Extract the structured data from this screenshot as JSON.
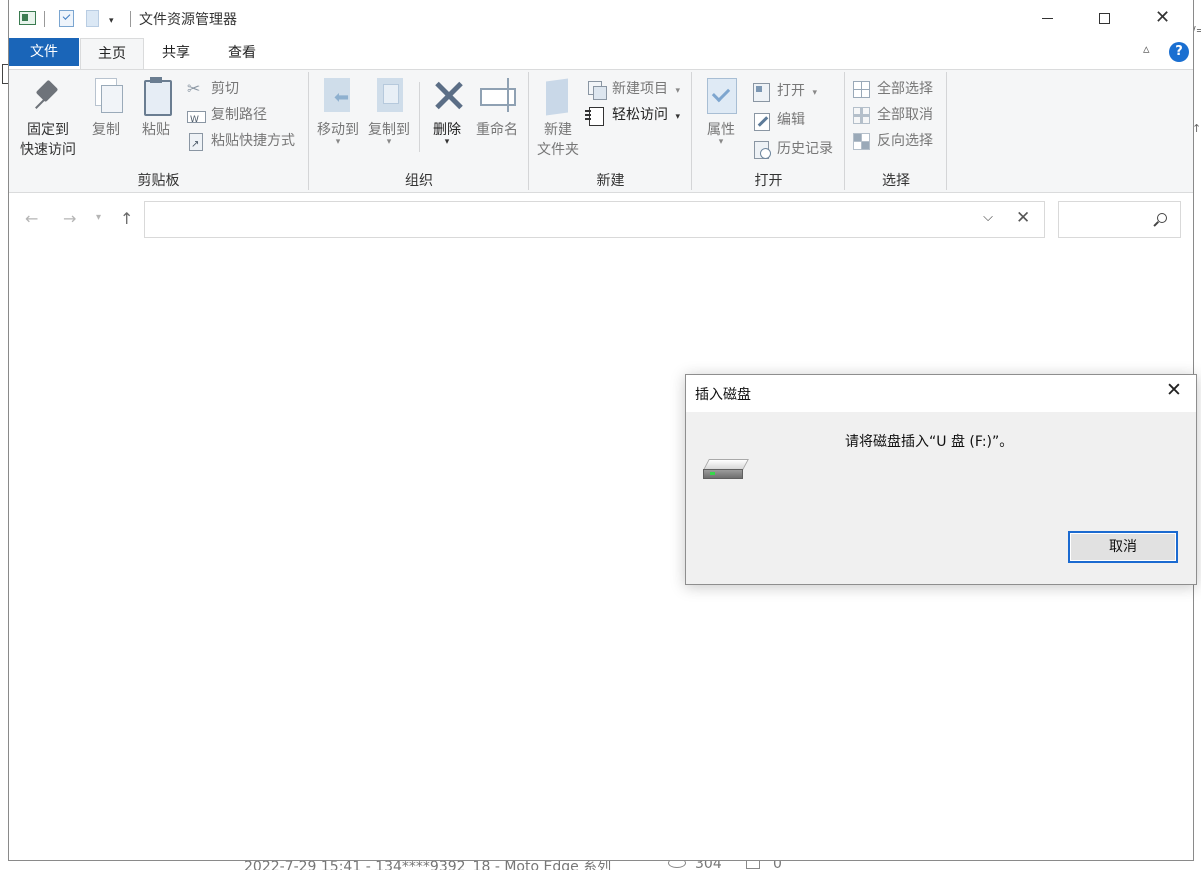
{
  "window": {
    "title": "文件资源管理器",
    "close_symbol": "✕"
  },
  "quick_access": {
    "dropdown_symbol": "▾"
  },
  "ribbon_tabs": {
    "file": "文件",
    "home": "主页",
    "share": "共享",
    "view": "查看",
    "collapse_symbol": "▵",
    "help_symbol": "?"
  },
  "ribbon": {
    "clipboard": {
      "label": "剪贴板",
      "pin_line1": "固定到",
      "pin_line2": "快速访问",
      "copy": "复制",
      "paste": "粘贴",
      "cut": "剪切",
      "copy_path": "复制路径",
      "paste_shortcut": "粘贴快捷方式"
    },
    "organize": {
      "label": "组织",
      "move_to": "移动到",
      "copy_to": "复制到",
      "delete": "删除",
      "rename": "重命名",
      "dropdown_symbol": "▾"
    },
    "new": {
      "label": "新建",
      "new_folder_line1": "新建",
      "new_folder_line2": "文件夹",
      "new_item": "新建项目",
      "easy_access": "轻松访问"
    },
    "open": {
      "label": "打开",
      "properties": "属性",
      "open": "打开",
      "edit": "编辑",
      "history": "历史记录"
    },
    "select": {
      "label": "选择",
      "select_all": "全部选择",
      "select_none": "全部取消",
      "invert": "反向选择"
    }
  },
  "navigation": {
    "back_symbol": "←",
    "forward_symbol": "→",
    "recent_symbol": "▾",
    "up_symbol": "↑",
    "address_value": "",
    "address_dropdown_symbol": "⌵",
    "clear_symbol": "✕",
    "search_value": ""
  },
  "dialog": {
    "title": "插入磁盘",
    "close_symbol": "✕",
    "message": "请将磁盘插入“U 盘 (F:)”。",
    "cancel": "取消"
  },
  "backdrop": {
    "post_meta": "2022-7-29 15:41 - 134****9392_18 - Moto Edge 系列",
    "views": "304",
    "comments": "0",
    "right_marks": [
      "/=",
      "↑"
    ]
  },
  "colors": {
    "accent": "#1a65b8",
    "dialog_focus": "#1b6ad0",
    "ribbon_bg": "#f5f6f7",
    "dialog_bg": "#f0f0f0"
  }
}
